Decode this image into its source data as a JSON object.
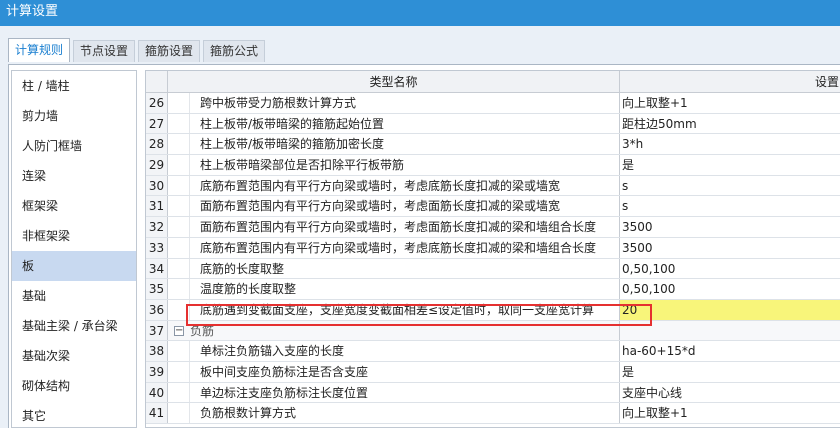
{
  "window": {
    "title": "计算设置"
  },
  "tabs": [
    {
      "label": "计算规则",
      "active": true
    },
    {
      "label": "节点设置",
      "active": false
    },
    {
      "label": "箍筋设置",
      "active": false
    },
    {
      "label": "箍筋公式",
      "active": false
    }
  ],
  "sidebar": {
    "items": [
      {
        "label": "柱 / 墙柱"
      },
      {
        "label": "剪力墙"
      },
      {
        "label": "人防门框墙"
      },
      {
        "label": "连梁"
      },
      {
        "label": "框架梁"
      },
      {
        "label": "非框架梁"
      },
      {
        "label": "板",
        "active": true
      },
      {
        "label": "基础"
      },
      {
        "label": "基础主梁 / 承台梁"
      },
      {
        "label": "基础次梁"
      },
      {
        "label": "砌体结构"
      },
      {
        "label": "其它"
      }
    ]
  },
  "grid": {
    "header": {
      "name": "类型名称",
      "value": "设置"
    },
    "rows": [
      {
        "num": "26",
        "name": "跨中板带受力筋根数计算方式",
        "value": "向上取整+1"
      },
      {
        "num": "27",
        "name": "柱上板带/板带暗梁的箍筋起始位置",
        "value": "距柱边50mm"
      },
      {
        "num": "28",
        "name": "柱上板带/板带暗梁的箍筋加密长度",
        "value": "3*h"
      },
      {
        "num": "29",
        "name": "柱上板带暗梁部位是否扣除平行板带筋",
        "value": "是"
      },
      {
        "num": "30",
        "name": "底筋布置范围内有平行方向梁或墙时，考虑底筋长度扣减的梁或墙宽",
        "value": "s"
      },
      {
        "num": "31",
        "name": "面筋布置范围内有平行方向梁或墙时，考虑面筋长度扣减的梁或墙宽",
        "value": "s"
      },
      {
        "num": "32",
        "name": "面筋布置范围内有平行方向梁或墙时，考虑面筋长度扣减的梁和墙组合长度",
        "value": "3500"
      },
      {
        "num": "33",
        "name": "底筋布置范围内有平行方向梁或墙时，考虑底筋长度扣减的梁和墙组合长度",
        "value": "3500"
      },
      {
        "num": "34",
        "name": "底筋的长度取整",
        "value": "0,50,100"
      },
      {
        "num": "35",
        "name": "温度筋的长度取整",
        "value": "0,50,100"
      },
      {
        "num": "36",
        "name": "底筋遇到变截面支座，支座宽度变截面相差≤设定值时，取同一支座宽计算",
        "value": "20",
        "selected": true
      },
      {
        "num": "37",
        "name": "负筋",
        "value": "",
        "group": true
      },
      {
        "num": "38",
        "name": "单标注负筋锚入支座的长度",
        "value": "ha-60+15*d"
      },
      {
        "num": "39",
        "name": "板中间支座负筋标注是否含支座",
        "value": "是"
      },
      {
        "num": "40",
        "name": "单边标注支座负筋标注长度位置",
        "value": "支座中心线"
      },
      {
        "num": "41",
        "name": "负筋根数计算方式",
        "value": "向上取整+1"
      }
    ]
  },
  "colors": {
    "titlebar": "#2e8fd6",
    "selected_value_bg": "#f8f57a",
    "highlight_border": "#e53030",
    "sidebar_active_bg": "#c8d9f0"
  }
}
